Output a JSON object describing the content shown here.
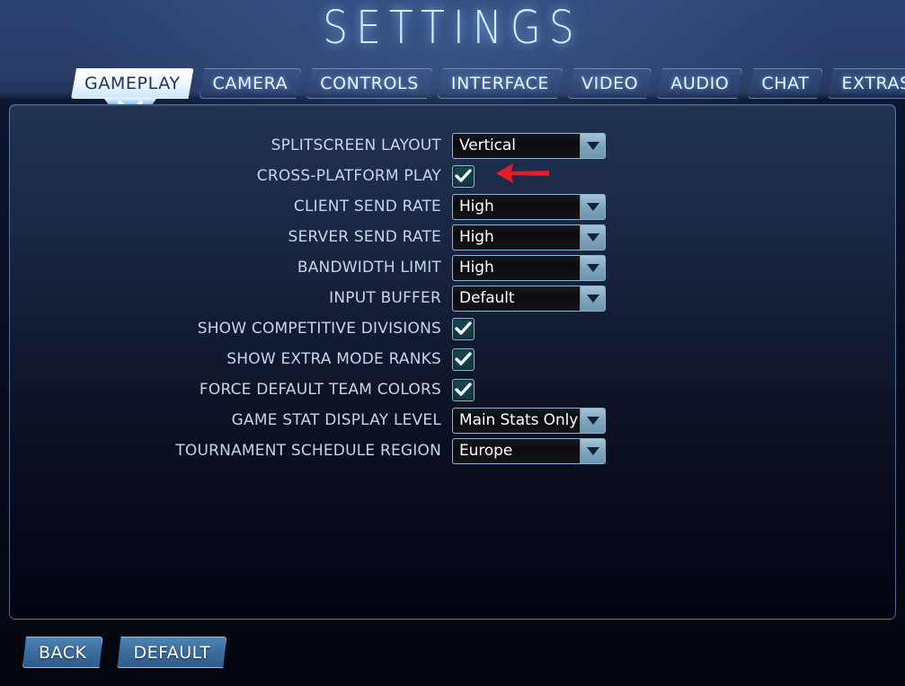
{
  "header": {
    "title": "SETTINGS"
  },
  "tabs": [
    {
      "label": "GAMEPLAY",
      "active": true
    },
    {
      "label": "CAMERA",
      "active": false
    },
    {
      "label": "CONTROLS",
      "active": false
    },
    {
      "label": "INTERFACE",
      "active": false
    },
    {
      "label": "VIDEO",
      "active": false
    },
    {
      "label": "AUDIO",
      "active": false
    },
    {
      "label": "CHAT",
      "active": false
    },
    {
      "label": "EXTRAS",
      "active": false
    }
  ],
  "settings": [
    {
      "label": "SPLITSCREEN LAYOUT",
      "type": "dropdown",
      "value": "Vertical"
    },
    {
      "label": "CROSS-PLATFORM PLAY",
      "type": "checkbox",
      "checked": true
    },
    {
      "label": "CLIENT SEND RATE",
      "type": "dropdown",
      "value": "High"
    },
    {
      "label": "SERVER SEND RATE",
      "type": "dropdown",
      "value": "High"
    },
    {
      "label": "BANDWIDTH LIMIT",
      "type": "dropdown",
      "value": "High"
    },
    {
      "label": "INPUT BUFFER",
      "type": "dropdown",
      "value": "Default"
    },
    {
      "label": "SHOW COMPETITIVE DIVISIONS",
      "type": "checkbox",
      "checked": true
    },
    {
      "label": "SHOW EXTRA MODE RANKS",
      "type": "checkbox",
      "checked": true
    },
    {
      "label": "FORCE DEFAULT TEAM COLORS",
      "type": "checkbox",
      "checked": true
    },
    {
      "label": "GAME STAT DISPLAY LEVEL",
      "type": "dropdown",
      "value": "Main Stats Only"
    },
    {
      "label": "TOURNAMENT SCHEDULE REGION",
      "type": "dropdown",
      "value": "Europe"
    }
  ],
  "footer": {
    "back_label": "BACK",
    "default_label": "DEFAULT"
  },
  "annotation": {
    "arrow_color": "#e01f22",
    "points_at": "CROSS-PLATFORM PLAY"
  },
  "colors": {
    "background_top": "#2c4372",
    "background_bottom": "#04060e",
    "panel_border": "#7eaadc",
    "active_tab_bg": "#ffffff",
    "active_tab_text": "#1d3563",
    "label_text": "#c5d5ea",
    "dropdown_bg": "#0b0c0f",
    "dropdown_button": "#7ea5bd",
    "checkbox_fill": "#16414a",
    "button_fill": "#3b6f9f"
  }
}
